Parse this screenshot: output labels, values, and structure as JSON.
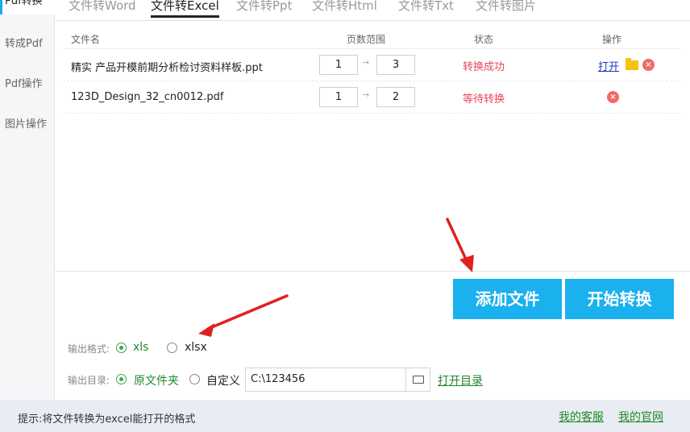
{
  "sidebar": {
    "items": [
      {
        "label": "Pdf转换",
        "active": true
      },
      {
        "label": "转成Pdf",
        "active": false
      },
      {
        "label": "Pdf操作",
        "active": false
      },
      {
        "label": "图片操作",
        "active": false
      }
    ]
  },
  "tabs": [
    {
      "label": "文件转Word",
      "active": false
    },
    {
      "label": "文件转Excel",
      "active": true
    },
    {
      "label": "文件转Ppt",
      "active": false
    },
    {
      "label": "文件转Html",
      "active": false
    },
    {
      "label": "文件转Txt",
      "active": false
    },
    {
      "label": "文件转图片",
      "active": false
    }
  ],
  "table": {
    "headers": {
      "filename": "文件名",
      "pages": "页数范围",
      "status": "状态",
      "actions": "操作"
    },
    "rows": [
      {
        "filename": "精实  产品开模前期分析检讨资料样板.ppt",
        "page_from": "1",
        "page_to": "3",
        "status": "转换成功",
        "open_label": "打开",
        "has_open": true
      },
      {
        "filename": "123D_Design_32_cn0012.pdf",
        "page_from": "1",
        "page_to": "2",
        "status": "等待转换",
        "open_label": "",
        "has_open": false
      }
    ]
  },
  "buttons": {
    "add_file": "添加文件",
    "start_convert": "开始转换"
  },
  "output_format": {
    "label": "输出格式:",
    "options": [
      "xls",
      "xlsx"
    ],
    "selected": "xls"
  },
  "output_dir": {
    "label": "输出目录:",
    "options": [
      "原文件夹",
      "自定义"
    ],
    "selected": "原文件夹",
    "path": "C:\\123456",
    "open_dir": "打开目录"
  },
  "statusbar": {
    "tip": "提示:将文件转换为excel能打开的格式",
    "service": "我的客服",
    "website": "我的官网"
  },
  "colors": {
    "accent": "#1bb1ee",
    "success": "#e8455a",
    "link_green": "#1f8a2a",
    "annotation": "#e02020"
  }
}
